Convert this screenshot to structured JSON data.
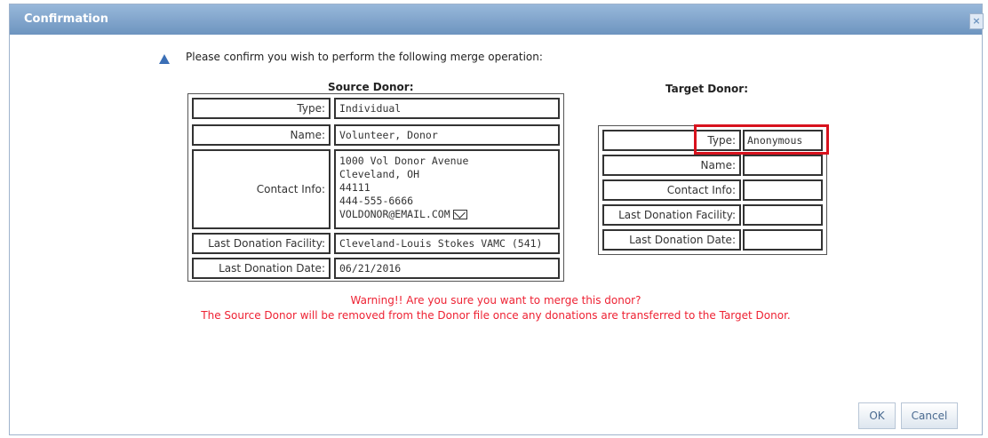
{
  "dialog": {
    "title": "Confirmation",
    "close_symbol": "×",
    "prompt": "Please confirm you wish to perform the following merge operation:",
    "icon": "warning-triangle-icon"
  },
  "source": {
    "heading": "Source Donor:",
    "rows": [
      {
        "label": "Type:",
        "value": "Individual"
      },
      {
        "label": "Name:",
        "value": "Volunteer, Donor"
      },
      {
        "label": "Contact Info:",
        "lines": [
          "1000 Vol Donor Avenue",
          "Cleveland, OH",
          "44111",
          "444-555-6666",
          "VOLDONOR@EMAIL.COM"
        ]
      },
      {
        "label": "Last Donation Facility:",
        "value": "Cleveland-Louis Stokes VAMC (541)"
      },
      {
        "label": "Last Donation Date:",
        "value": "06/21/2016"
      }
    ]
  },
  "target": {
    "heading": "Target Donor:",
    "rows": [
      {
        "label": "Type:",
        "value": "Anonymous"
      },
      {
        "label": "Name:",
        "value": ""
      },
      {
        "label": "Contact Info:",
        "value": ""
      },
      {
        "label": "Last Donation Facility:",
        "value": ""
      },
      {
        "label": "Last Donation Date:",
        "value": ""
      }
    ]
  },
  "warning": {
    "line1": "Warning!! Are you sure you want to merge this donor?",
    "line2": "The Source Donor will be removed from the Donor file once any donations are transferred to the Target Donor."
  },
  "buttons": {
    "ok": "OK",
    "cancel": "Cancel"
  },
  "colors": {
    "titlebar": "#6d94bf",
    "warning": "#ee2233",
    "highlight": "#d8121d"
  }
}
